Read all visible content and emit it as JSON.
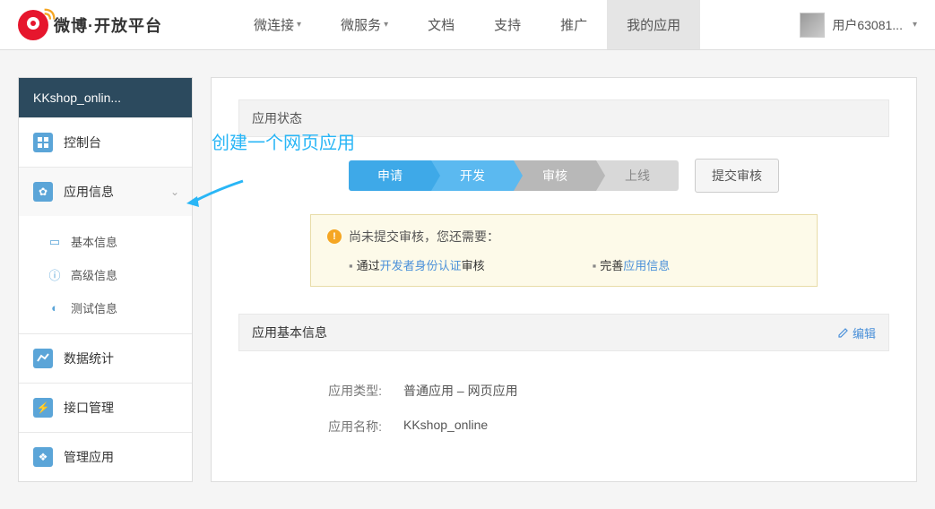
{
  "header": {
    "logo_text": "微博·开放平台",
    "nav": [
      {
        "label": "微连接",
        "dropdown": true
      },
      {
        "label": "微服务",
        "dropdown": true
      },
      {
        "label": "文档",
        "dropdown": false
      },
      {
        "label": "支持",
        "dropdown": false
      },
      {
        "label": "推广",
        "dropdown": false
      },
      {
        "label": "我的应用",
        "dropdown": false,
        "active": true
      }
    ],
    "user": "用户63081..."
  },
  "sidebar": {
    "title": "KKshop_onlin...",
    "items": [
      {
        "label": "控制台"
      },
      {
        "label": "应用信息",
        "expanded": true,
        "sub": [
          {
            "label": "基本信息"
          },
          {
            "label": "高级信息"
          },
          {
            "label": "测试信息"
          }
        ]
      },
      {
        "label": "数据统计"
      },
      {
        "label": "接口管理"
      },
      {
        "label": "管理应用"
      }
    ]
  },
  "main": {
    "annotation": "创建一个网页应用",
    "status_title": "应用状态",
    "steps": [
      "申请",
      "开发",
      "审核",
      "上线"
    ],
    "submit_btn": "提交审核",
    "notice": {
      "title": "尚未提交审核，您还需要：",
      "item1_prefix": "通过",
      "item1_link": "开发者身份认证",
      "item1_suffix": "审核",
      "item2_prefix": "完善",
      "item2_link": "应用信息"
    },
    "basic_info_title": "应用基本信息",
    "edit_label": "编辑",
    "fields": {
      "type_label": "应用类型:",
      "type_value": "普通应用   –   网页应用",
      "name_label": "应用名称:",
      "name_value": "KKshop_online"
    }
  }
}
